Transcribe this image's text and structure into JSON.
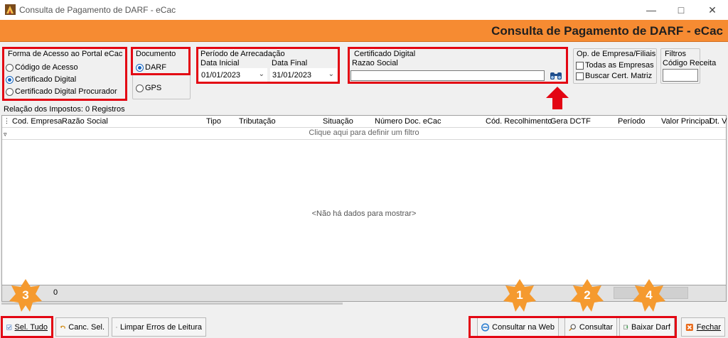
{
  "window": {
    "title": "Consulta de Pagamento de DARF - eCac",
    "banner_title": "Consulta de Pagamento de DARF - eCac",
    "min_icon": "minimize-icon",
    "max_icon": "maximize-icon",
    "close_icon": "close-icon"
  },
  "forma_acesso": {
    "label": "Forma de Acesso ao Portal eCac",
    "options": [
      "Código de Acesso",
      "Certificado Digital",
      "Certificado Digital Procurador"
    ],
    "selected": "Certificado Digital"
  },
  "documento": {
    "label": "Documento",
    "options": [
      "DARF",
      "GPS"
    ],
    "selected": "DARF"
  },
  "periodo": {
    "label": "Período de Arrecadação",
    "inicial_label": "Data Inicial",
    "inicial_value": "01/01/2023",
    "final_label": "Data Final",
    "final_value": "31/01/2023"
  },
  "certificado": {
    "label": "Certificado Digital",
    "razao_label": "Razao Social",
    "razao_value": "",
    "search_icon": "binoculars-icon"
  },
  "op_empresa": {
    "label": "Op. de Empresa/Filiais",
    "todas": "Todas as Empresas",
    "buscar": "Buscar Cert. Matriz"
  },
  "filtros": {
    "label": "Filtros",
    "codigo_label": "Código Receita",
    "codigo_value": ""
  },
  "grid": {
    "records_label": "Relação dos Impostos: 0 Registros",
    "columns": [
      "Cod. Empresa",
      "Razão Social",
      "Tipo",
      "Tributação",
      "Situação",
      "Número Doc. eCac",
      "Cód. Recolhimento",
      "Gera DCTF",
      "Período",
      "Valor Principal",
      "Dt. V"
    ],
    "filter_hint": "Clique aqui para definir um filtro",
    "empty_text": "<Não há dados para mostrar>",
    "footer_count": "0"
  },
  "buttons": {
    "sel_tudo": "Sel. Tudo",
    "canc_sel": "Canc. Sel.",
    "limpar": "Limpar Erros de Leitura",
    "consultar_web": "Consultar na Web",
    "consultar": "Consultar",
    "baixar": "Baixar Darf",
    "fechar": "Fechar"
  },
  "markers": [
    "1",
    "2",
    "3",
    "4"
  ],
  "colors": {
    "banner": "#f68b32",
    "highlight": "#e30613",
    "marker": "#f59a2f",
    "arrow": "#e30613"
  }
}
